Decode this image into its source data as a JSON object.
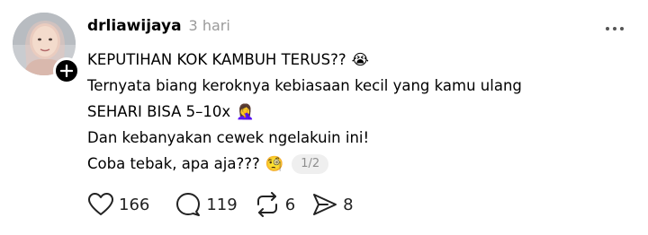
{
  "author": {
    "username": "drliawijaya",
    "time": "3 hari"
  },
  "post": {
    "lines": [
      "KEPUTIHAN KOK KAMBUH TERUS??",
      "Ternyata biang keroknya kebiasaan kecil yang kamu ulang",
      "SEHARI BISA 5–10x",
      "Dan kebanyakan cewek ngelakuin ini!",
      "Coba tebak, apa aja???"
    ],
    "emojis": [
      "😭",
      "🤦‍♀️",
      "🧐"
    ],
    "page_indicator": "1/2"
  },
  "actions": {
    "likes": "166",
    "replies": "119",
    "reposts": "6",
    "shares": "8"
  },
  "icons": {
    "more": "more-horizontal-icon",
    "follow": "plus-icon",
    "like": "heart-icon",
    "reply": "comment-bubble-icon",
    "repost": "repost-icon",
    "share": "send-icon"
  },
  "colors": {
    "text": "#000000",
    "muted": "#9a9a9a",
    "pill_bg": "#efefef"
  }
}
